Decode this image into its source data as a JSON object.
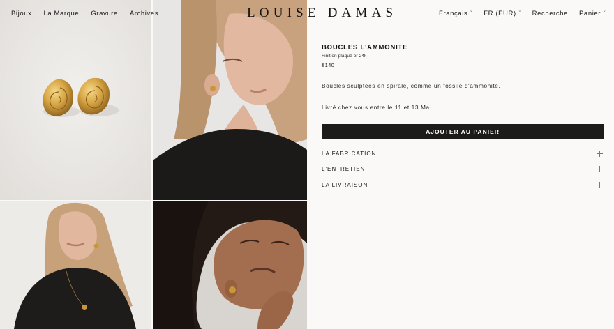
{
  "brand": {
    "name": "LOUISE DAMAS"
  },
  "nav": {
    "left": [
      "Bijoux",
      "La Marque",
      "Gravure",
      "Archives"
    ],
    "language": "Français",
    "currency": "FR (EUR)",
    "search": "Recherche",
    "cart": "Panier"
  },
  "product": {
    "title": "BOUCLES L'AMMONITE",
    "finish": "Finition plaqué or 24k",
    "price": "€140",
    "description": "Boucles sculptées en spirale, comme un fossile d'ammonite.",
    "delivery": "Livré chez vous entre le 11 et 13 Mai",
    "add_to_cart": "AJOUTER AU PANIER",
    "accordion": [
      "LA FABRICATION",
      "L'ENTRETIEN",
      "LA LIVRAISON"
    ]
  },
  "gallery": {
    "images": [
      "product-earrings-photo",
      "model-portrait-side-photo",
      "model-looking-up-photo",
      "model-curly-hair-photo"
    ]
  },
  "colors": {
    "background": "#faf9f7",
    "text": "#1a1918",
    "button": "#1c1b1a",
    "gold": "#c9973a"
  }
}
